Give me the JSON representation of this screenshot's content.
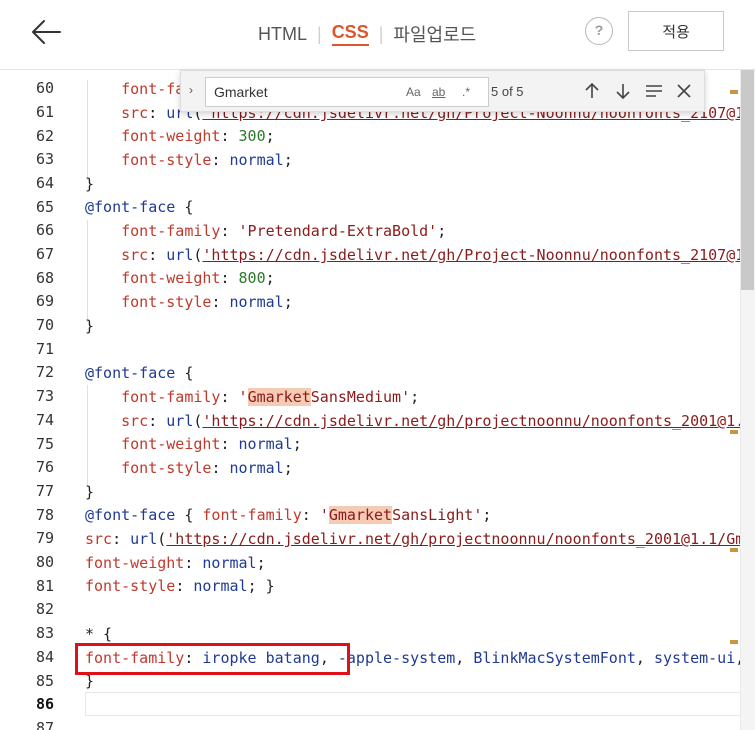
{
  "header": {
    "tabs": [
      {
        "label": "HTML",
        "active": false
      },
      {
        "label": "CSS",
        "active": true
      },
      {
        "label": "파일업로드",
        "active": false
      }
    ],
    "help_label": "?",
    "apply_label": "적용",
    "accent_color": "#e0542b"
  },
  "find": {
    "query": "Gmarket",
    "match_case": "Aa",
    "whole_word": "ab",
    "regex": ".*",
    "count": "5 of 5"
  },
  "editor": {
    "line_numbers": [
      "60",
      "61",
      "62",
      "63",
      "64",
      "65",
      "66",
      "67",
      "68",
      "69",
      "70",
      "71",
      "72",
      "73",
      "74",
      "75",
      "76",
      "77",
      "78",
      "79",
      "80",
      "81",
      "82",
      "83",
      "84",
      "85",
      "86",
      "87"
    ],
    "current_line": "86",
    "highlight_color": "#f6cbb4",
    "annotation_color": "#e0101a"
  }
}
